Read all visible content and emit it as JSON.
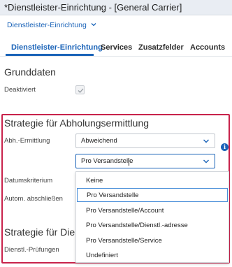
{
  "window": {
    "title": "*Dienstleister-Einrichtung - [General Carrier]"
  },
  "breadcrumb": {
    "label": "Dienstleister-Einrichtung"
  },
  "tabs": [
    {
      "label": "Dienstleister-Einrichtung",
      "active": true
    },
    {
      "label": "Services"
    },
    {
      "label": "Zusatzfelder"
    },
    {
      "label": "Accounts"
    }
  ],
  "grunddaten": {
    "heading": "Grunddaten",
    "deaktiviert_label": "Deaktiviert",
    "deaktiviert_checked": true
  },
  "strategie_abholung": {
    "heading": "Strategie für Abholungsermittlung",
    "abh_label": "Abh.-Ermittlung",
    "abh_value": "Abweichend",
    "second_select_value": "Pro Versandstelle",
    "datumskriterium_label": "Datumskriterium",
    "autom_label": "Autom. abschließen",
    "dropdown_options": [
      "Keine",
      "Pro Versandstelle",
      "Pro Versandstelle/Account",
      "Pro Versandstelle/Dienstl.-adresse",
      "Pro Versandstelle/Service",
      "Undefiniert"
    ],
    "selected_option_index": 1
  },
  "strategie_dienst": {
    "heading": "Strategie für Diens",
    "pruefungen_label": "Dienstl.-Prüfungen"
  },
  "info_icon": "i",
  "colors": {
    "accent": "#1a63b8",
    "highlight": "#c8234b"
  }
}
